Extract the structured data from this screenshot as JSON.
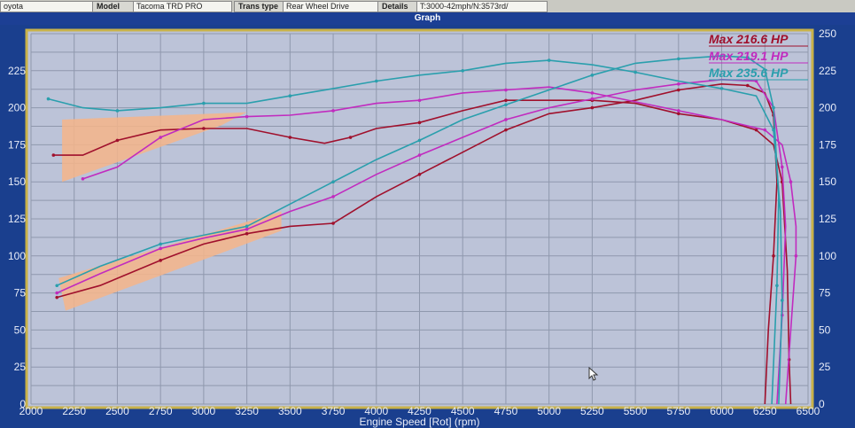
{
  "fields": {
    "make_value": "oyota",
    "model_label": "Model",
    "model_value": "Tacoma TRD PRO",
    "trans_label": "Trans type",
    "trans_value": "Rear Wheel Drive",
    "details_label": "Details",
    "details_value": "T:3000-42mph/N:3573rd/"
  },
  "graph_title": "Graph",
  "colors": {
    "panel": "#1a3f8e",
    "plot_bg": "#bcc3d8",
    "plot_border": "#c8b24a",
    "highlight": "#f6b58a"
  },
  "chart_data": {
    "type": "line",
    "xlabel": "Engine Speed [Rot] (rpm)",
    "xlim": [
      2000,
      6500
    ],
    "x_ticks": [
      2000,
      2250,
      2500,
      2750,
      3000,
      3250,
      3500,
      3750,
      4000,
      4250,
      4500,
      4750,
      5000,
      5250,
      5500,
      5750,
      6000,
      6250,
      6500
    ],
    "y_left_ticks": [
      0,
      25,
      50,
      75,
      100,
      125,
      150,
      175,
      200,
      225
    ],
    "y_right_ticks": [
      0,
      25,
      50,
      75,
      100,
      125,
      150,
      175,
      200,
      225,
      250
    ],
    "ylim": [
      0,
      250
    ],
    "grid": true,
    "legend": [
      {
        "text": "Max 216.6 HP",
        "color": "#a0102c"
      },
      {
        "text": "Max 219.1 HP",
        "color": "#c12bbf"
      },
      {
        "text": "Max 235.6 HP",
        "color": "#2a9fad"
      }
    ],
    "series": [
      {
        "name": "Max 216.6 HP",
        "kind": "torque",
        "color": "#a0102c",
        "points": [
          [
            2130,
            168
          ],
          [
            2300,
            168
          ],
          [
            2500,
            178
          ],
          [
            2750,
            185
          ],
          [
            3000,
            186
          ],
          [
            3250,
            186
          ],
          [
            3500,
            180
          ],
          [
            3700,
            176
          ],
          [
            3850,
            180
          ],
          [
            4000,
            186
          ],
          [
            4250,
            190
          ],
          [
            4500,
            198
          ],
          [
            4750,
            205
          ],
          [
            5000,
            205
          ],
          [
            5250,
            205
          ],
          [
            5500,
            203
          ],
          [
            5750,
            196
          ],
          [
            6000,
            192
          ],
          [
            6200,
            185
          ],
          [
            6300,
            175
          ],
          [
            6350,
            150
          ],
          [
            6380,
            90
          ],
          [
            6390,
            30
          ],
          [
            6400,
            0
          ]
        ]
      },
      {
        "name": "Max 216.6 HP",
        "kind": "power",
        "color": "#a0102c",
        "points": [
          [
            2150,
            72
          ],
          [
            2400,
            80
          ],
          [
            2750,
            97
          ],
          [
            3000,
            108
          ],
          [
            3250,
            115
          ],
          [
            3500,
            120
          ],
          [
            3750,
            122
          ],
          [
            4000,
            140
          ],
          [
            4250,
            155
          ],
          [
            4500,
            170
          ],
          [
            4750,
            185
          ],
          [
            5000,
            196
          ],
          [
            5250,
            200
          ],
          [
            5500,
            205
          ],
          [
            5750,
            212
          ],
          [
            6000,
            216
          ],
          [
            6150,
            215
          ],
          [
            6250,
            210
          ],
          [
            6300,
            195
          ],
          [
            6320,
            150
          ],
          [
            6300,
            100
          ],
          [
            6270,
            50
          ],
          [
            6250,
            0
          ]
        ]
      },
      {
        "name": "Max 219.1 HP",
        "kind": "torque",
        "color": "#c12bbf",
        "points": [
          [
            2300,
            152
          ],
          [
            2500,
            160
          ],
          [
            2750,
            180
          ],
          [
            3000,
            192
          ],
          [
            3250,
            194
          ],
          [
            3500,
            195
          ],
          [
            3750,
            198
          ],
          [
            4000,
            203
          ],
          [
            4250,
            205
          ],
          [
            4500,
            210
          ],
          [
            4750,
            212
          ],
          [
            5000,
            214
          ],
          [
            5250,
            210
          ],
          [
            5500,
            204
          ],
          [
            5750,
            198
          ],
          [
            6000,
            192
          ],
          [
            6250,
            185
          ],
          [
            6350,
            175
          ],
          [
            6400,
            150
          ],
          [
            6430,
            120
          ],
          [
            6430,
            100
          ],
          [
            6400,
            50
          ],
          [
            6370,
            0
          ]
        ]
      },
      {
        "name": "Max 219.1 HP",
        "kind": "power",
        "color": "#c12bbf",
        "points": [
          [
            2150,
            75
          ],
          [
            2400,
            88
          ],
          [
            2750,
            105
          ],
          [
            3000,
            112
          ],
          [
            3250,
            118
          ],
          [
            3500,
            130
          ],
          [
            3750,
            140
          ],
          [
            4000,
            155
          ],
          [
            4250,
            168
          ],
          [
            4500,
            180
          ],
          [
            4750,
            192
          ],
          [
            5000,
            200
          ],
          [
            5250,
            206
          ],
          [
            5500,
            212
          ],
          [
            5750,
            216
          ],
          [
            6000,
            219
          ],
          [
            6200,
            218
          ],
          [
            6300,
            200
          ],
          [
            6350,
            160
          ],
          [
            6370,
            120
          ],
          [
            6350,
            60
          ],
          [
            6320,
            0
          ]
        ]
      },
      {
        "name": "Max 235.6 HP",
        "kind": "torque",
        "color": "#2a9fad",
        "points": [
          [
            2100,
            206
          ],
          [
            2300,
            200
          ],
          [
            2500,
            198
          ],
          [
            2750,
            200
          ],
          [
            3000,
            203
          ],
          [
            3250,
            203
          ],
          [
            3500,
            208
          ],
          [
            3750,
            213
          ],
          [
            4000,
            218
          ],
          [
            4250,
            222
          ],
          [
            4500,
            225
          ],
          [
            4750,
            230
          ],
          [
            5000,
            232
          ],
          [
            5250,
            229
          ],
          [
            5500,
            224
          ],
          [
            5750,
            218
          ],
          [
            6000,
            213
          ],
          [
            6200,
            208
          ],
          [
            6300,
            185
          ],
          [
            6340,
            130
          ],
          [
            6350,
            70
          ],
          [
            6330,
            0
          ]
        ]
      },
      {
        "name": "Max 235.6 HP",
        "kind": "power",
        "color": "#2a9fad",
        "points": [
          [
            2150,
            80
          ],
          [
            2400,
            93
          ],
          [
            2750,
            108
          ],
          [
            3000,
            114
          ],
          [
            3250,
            120
          ],
          [
            3500,
            135
          ],
          [
            3750,
            150
          ],
          [
            4000,
            165
          ],
          [
            4250,
            178
          ],
          [
            4500,
            192
          ],
          [
            4750,
            202
          ],
          [
            5000,
            212
          ],
          [
            5250,
            222
          ],
          [
            5500,
            230
          ],
          [
            5750,
            233
          ],
          [
            6000,
            235
          ],
          [
            6150,
            234
          ],
          [
            6250,
            226
          ],
          [
            6300,
            200
          ],
          [
            6330,
            140
          ],
          [
            6320,
            80
          ],
          [
            6290,
            0
          ]
        ]
      }
    ]
  }
}
